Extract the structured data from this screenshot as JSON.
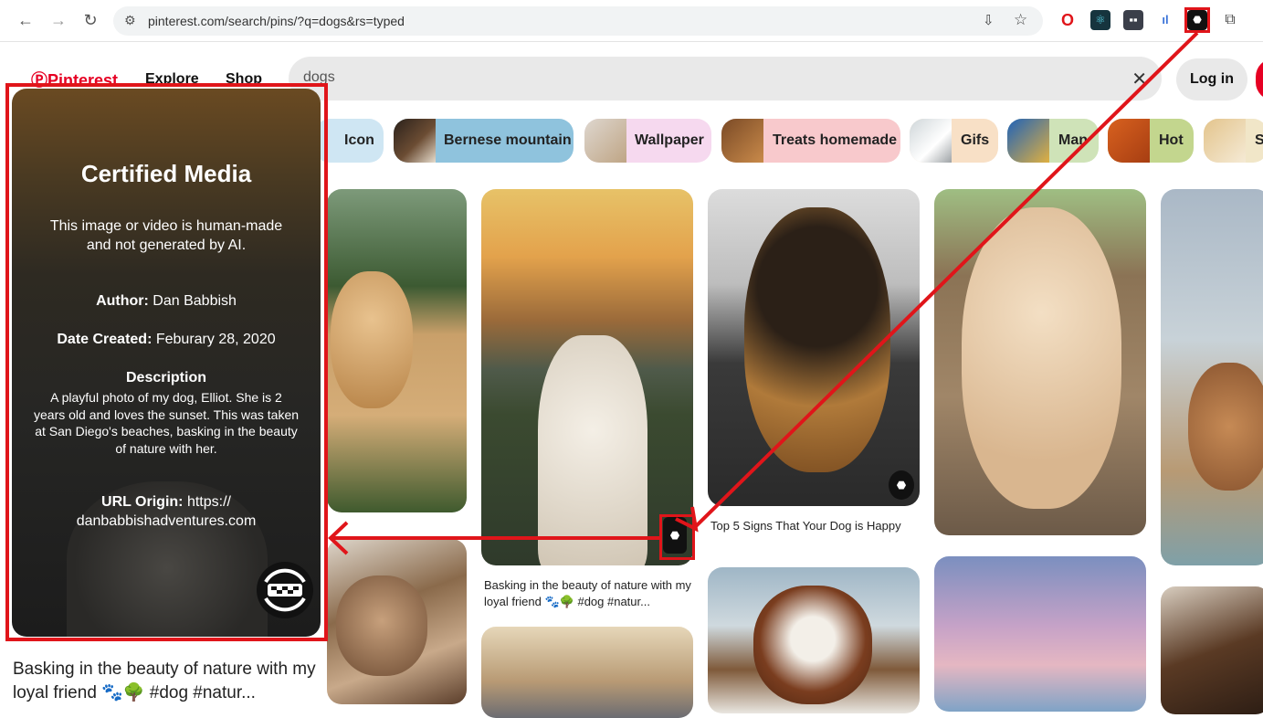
{
  "browser": {
    "url": "pinterest.com/search/pins/?q=dogs&rs=typed"
  },
  "header": {
    "logo": "Pinterest",
    "explore": "Explore",
    "shop": "Shop",
    "search_value": "dogs",
    "login": "Log in"
  },
  "chips": [
    {
      "label": "Icon",
      "color": "#cfe6f3"
    },
    {
      "label": "Bernese mountain",
      "color": "#8fc3dd"
    },
    {
      "label": "Wallpaper",
      "color": "#f6d9ef"
    },
    {
      "label": "Treats homemade",
      "color": "#f8c9cc"
    },
    {
      "label": "Gifs",
      "color": "#f8e0c6"
    },
    {
      "label": "Man",
      "color": "#cfe3b8"
    },
    {
      "label": "Hot",
      "color": "#c3d68e"
    },
    {
      "label": "S",
      "color": "#f1e6c8"
    }
  ],
  "pins": {
    "caption_a": "Basking in the beauty of nature with my loyal friend 🐾🌳 #dog #natur...",
    "caption_b": "Top 5 Signs That Your Dog is Happy",
    "caption_left": "Basking in the beauty of nature with my loyal friend 🐾🌳 #dog #natur..."
  },
  "certified": {
    "title": "Certified Media",
    "subtitle": "This image or video is human-made and not generated by AI.",
    "author_label": "Author:",
    "author_value": "Dan Babbish",
    "date_label": "Date Created:",
    "date_value": "Feburary 28, 2020",
    "description_label": "Description",
    "description": "A playful photo of my dog, Elliot. She is 2 years old and loves the sunset. This was taken at San Diego's beaches, basking in the beauty of nature with her.",
    "url_label": "URL Origin:",
    "url_value": "https:// danbabbishadventures.com"
  },
  "colors": {
    "brand": "#e60023",
    "annotation": "#e0151a"
  }
}
